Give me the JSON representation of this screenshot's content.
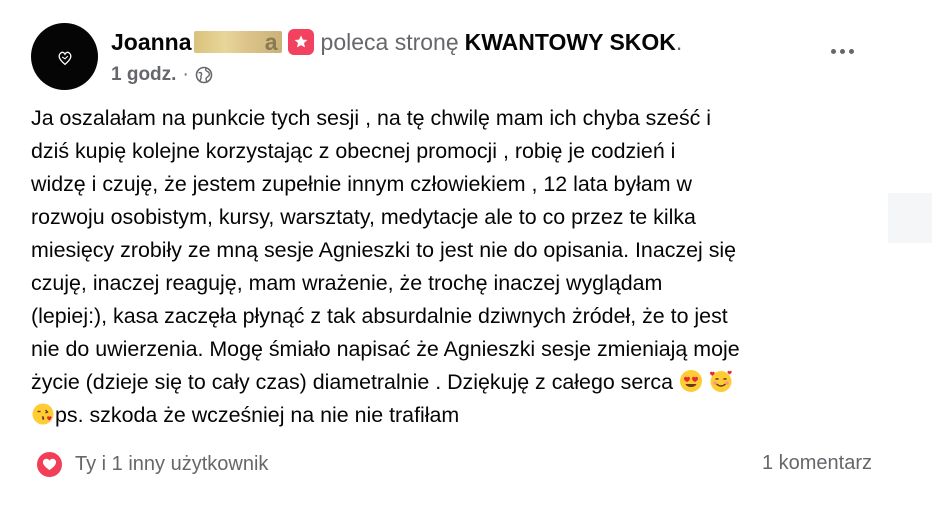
{
  "post": {
    "author_name": "Joanna",
    "redaction_tail": "a",
    "verb": "poleca stronę",
    "page_name": "KWANTOWY SKOK",
    "period": ".",
    "time": "1 godz.",
    "dot": "·",
    "audience_icon": "globe-icon",
    "recommend_icon": "recommend-star-icon",
    "more_icon": "more-options-icon",
    "body_lines": [
      "Ja oszalałam na punkcie tych sesji , na tę chwilę mam ich chyba sześć i",
      "dziś kupię kolejne korzystając z obecnej promocji , robię je codzień i",
      "widzę i czuję, że jestem zupełnie innym człowiekiem , 12 lata byłam w",
      "rozwoju osobistym, kursy, warsztaty, medytacje ale to co przez te kilka",
      "miesięcy zrobiły ze mną sesje Agnieszki to jest nie do opisania. Inaczej się",
      "czuję, inaczej reaguję, mam wrażenie, że trochę inaczej wyglądam",
      "(lepiej:), kasa zaczęła płynąć z tak absurdalnie dziwnych żródeł, że to jest",
      "nie do uwierzenia. Mogę śmiało napisać że Agnieszki sesje zmieniają moje",
      "życie (dzieje się to cały czas) diametralnie . Dziękuję z całego serca",
      "ps. szkoda że wcześniej na nie nie trafiłam"
    ],
    "emojis": [
      "heart-eyes-emoji",
      "smiling-face-with-hearts-emoji",
      "face-blowing-kiss-emoji"
    ],
    "reactions_text": "Ty i 1 inny użytkownik",
    "reaction_icon": "heart-reaction-icon",
    "comments_text": "1 komentarz"
  },
  "colors": {
    "secondary_text": "#65676b",
    "primary_text": "#050505",
    "heart_reaction": "#f33e58",
    "recommend_badge": "#f3425f"
  }
}
